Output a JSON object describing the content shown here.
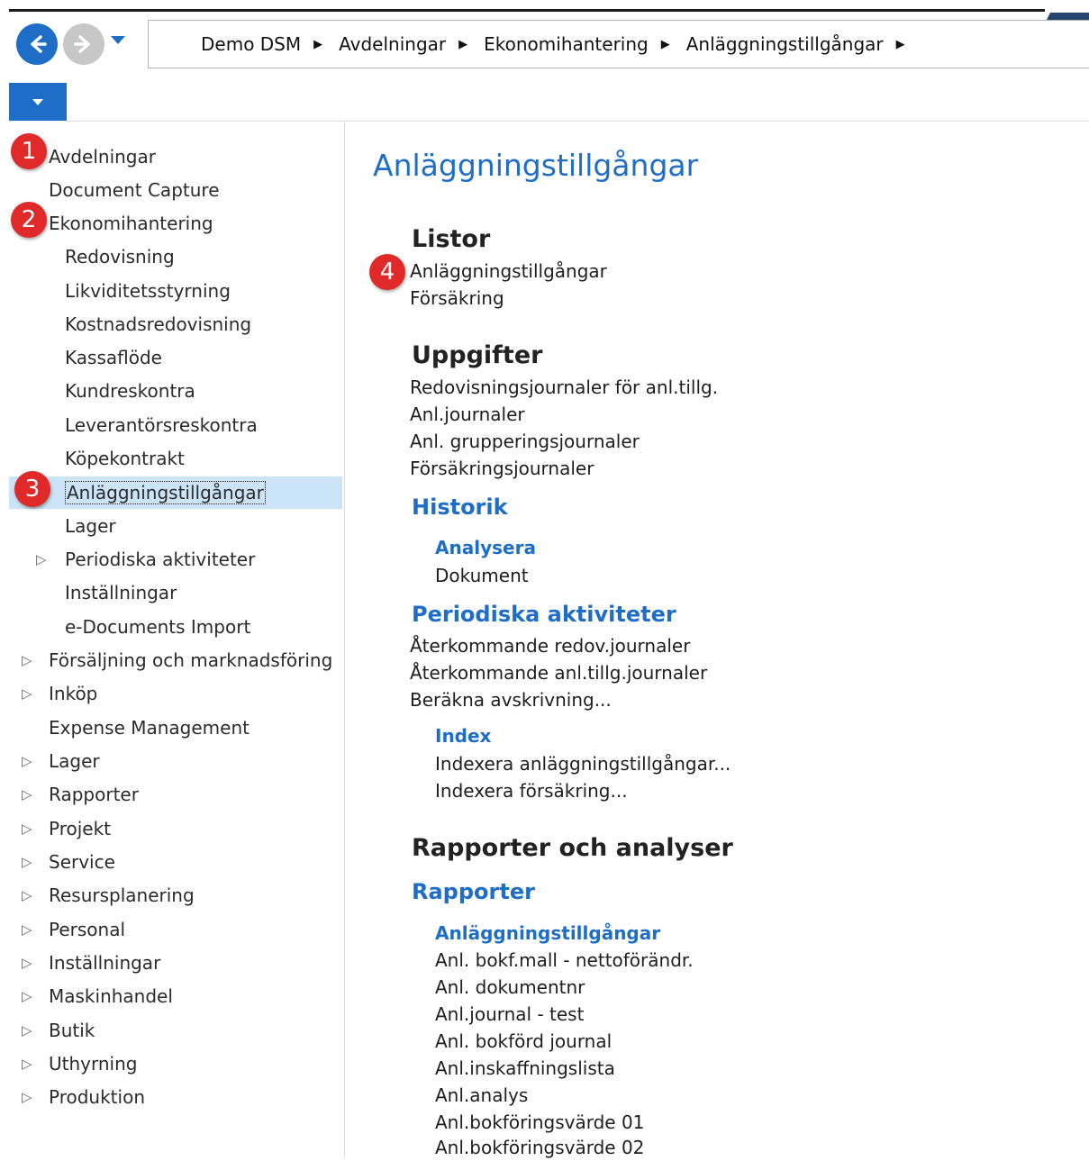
{
  "breadcrumb": [
    "Demo DSM",
    "Avdelningar",
    "Ekonomihantering",
    "Anläggningstillgångar"
  ],
  "colors": {
    "accent": "#1e6ec8",
    "badge": "#e02a2a",
    "selection": "#cce4f7"
  },
  "badges": [
    "1",
    "2",
    "3",
    "4"
  ],
  "sidebar": {
    "items": [
      {
        "label": "Avdelningar"
      },
      {
        "label": "Document Capture"
      },
      {
        "label": "Ekonomihantering"
      },
      {
        "label": "Redovisning"
      },
      {
        "label": "Likviditetsstyrning"
      },
      {
        "label": "Kostnadsredovisning"
      },
      {
        "label": "Kassaflöde"
      },
      {
        "label": "Kundreskontra"
      },
      {
        "label": "Leverantörsreskontra"
      },
      {
        "label": "Köpekontrakt"
      },
      {
        "label": "Anläggningstillgångar"
      },
      {
        "label": "Lager"
      },
      {
        "label": "Periodiska aktiviteter"
      },
      {
        "label": "Inställningar"
      },
      {
        "label": "e-Documents Import"
      },
      {
        "label": "Försäljning och marknadsföring"
      },
      {
        "label": "Inköp"
      },
      {
        "label": "Expense Management"
      },
      {
        "label": "Lager"
      },
      {
        "label": "Rapporter"
      },
      {
        "label": "Projekt"
      },
      {
        "label": "Service"
      },
      {
        "label": "Resursplanering"
      },
      {
        "label": "Personal"
      },
      {
        "label": "Inställningar"
      },
      {
        "label": "Maskinhandel"
      },
      {
        "label": "Butik"
      },
      {
        "label": "Uthyrning"
      },
      {
        "label": "Produktion"
      }
    ]
  },
  "main": {
    "title": "Anläggningstillgångar",
    "listor": {
      "heading": "Listor",
      "items": [
        "Anläggningstillgångar",
        "Försäkring"
      ]
    },
    "uppgifter": {
      "heading": "Uppgifter",
      "items": [
        "Redovisningsjournaler för anl.tillg.",
        "Anl.journaler",
        "Anl. grupperingsjournaler",
        "Försäkringsjournaler"
      ]
    },
    "historik": {
      "heading": "Historik",
      "analysera": {
        "heading": "Analysera",
        "items": [
          "Dokument"
        ]
      }
    },
    "periodiska": {
      "heading": "Periodiska aktiviteter",
      "items": [
        "Återkommande redov.journaler",
        "Återkommande anl.tillg.journaler",
        "Beräkna avskrivning..."
      ],
      "index": {
        "heading": "Index",
        "items": [
          "Indexera anläggningstillgångar...",
          "Indexera försäkring..."
        ]
      }
    },
    "rapporter_analyser": {
      "heading": "Rapporter och analyser",
      "rapporter": {
        "heading": "Rapporter",
        "anl": {
          "heading": "Anläggningstillgångar",
          "items": [
            "Anl. bokf.mall - nettoförändr.",
            "Anl. dokumentnr",
            "Anl.journal - test",
            "Anl. bokförd journal",
            "Anl.inskaffningslista",
            "Anl.analys",
            "Anl.bokföringsvärde 01",
            "Anl.bokföringsvärde 02"
          ]
        }
      }
    }
  }
}
